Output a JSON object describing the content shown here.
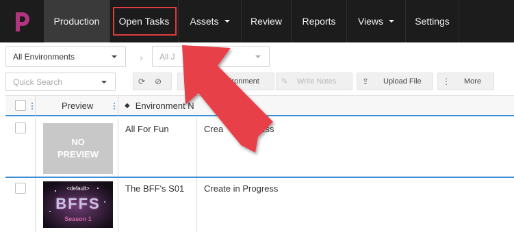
{
  "nav": {
    "items": [
      {
        "label": "Production"
      },
      {
        "label": "Open Tasks"
      },
      {
        "label": "Assets"
      },
      {
        "label": "Review"
      },
      {
        "label": "Reports"
      },
      {
        "label": "Views"
      },
      {
        "label": "Settings"
      }
    ]
  },
  "filters": {
    "environment_select": "All Environments",
    "job_select": "All J",
    "quick_search_placeholder": "Quick Search"
  },
  "toolbar": {
    "environment_label": "ironment",
    "write_notes_label": "Write Notes",
    "upload_file_label": "Upload File",
    "more_label": "More"
  },
  "table": {
    "columns": [
      "Preview",
      "Environment N"
    ],
    "rows": [
      {
        "preview": "NO PREVIEW",
        "name": "All For Fun",
        "status": "Crea",
        "status_tail": "ress"
      },
      {
        "preview_caption": "<default>",
        "preview_title": "BFFS",
        "preview_sub": "Season 1",
        "name": "The BFF's S01",
        "status": "Create in Progress"
      }
    ]
  },
  "colors": {
    "nav_bg": "#1c1c1c",
    "highlight": "#e03c3c",
    "arrow": "#e8404a",
    "accent_line": "#3c8fd6",
    "logo": "#b0347e"
  }
}
